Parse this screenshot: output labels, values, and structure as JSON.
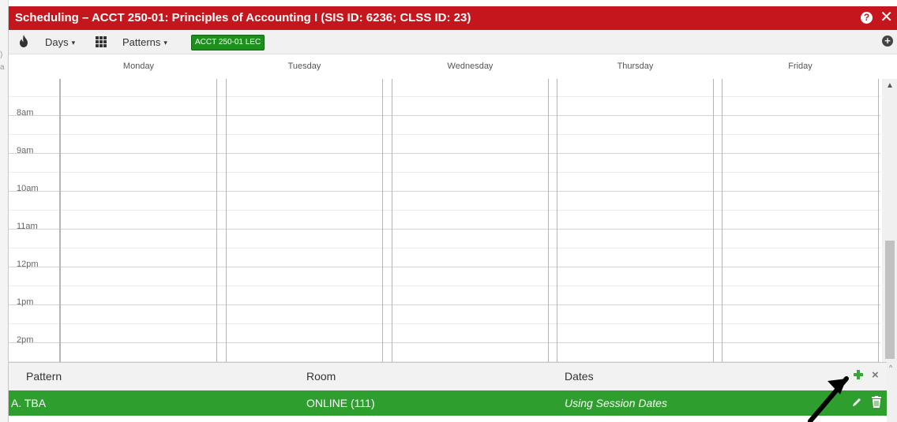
{
  "dialog": {
    "title": "Scheduling – ACCT 250-01: Principles of Accounting I (SIS ID: 6236; CLSS ID: 23)",
    "help_icon": "?",
    "close_icon": "✕"
  },
  "toolbar": {
    "days_label": "Days",
    "patterns_label": "Patterns",
    "section_badge": "ACCT 250-01 LEC",
    "add_icon": "+",
    "caret": "▾"
  },
  "calendar": {
    "days": [
      "Monday",
      "Tuesday",
      "Wednesday",
      "Thursday",
      "Friday"
    ],
    "times": [
      "8am",
      "9am",
      "10am",
      "11am",
      "12pm",
      "1pm",
      "2pm"
    ]
  },
  "patterns": {
    "headers": {
      "pattern": "Pattern",
      "room": "Room",
      "dates": "Dates"
    },
    "rows": [
      {
        "pattern": "A. TBA",
        "room": "ONLINE (111)",
        "dates": "Using Session Dates"
      }
    ]
  },
  "background": {
    "glyphs": [
      ")",
      "a"
    ]
  },
  "colors": {
    "title_bar": "#c4161c",
    "badge": "#1d8f1d",
    "selected_row": "#2e9e2e",
    "add_plus": "#3aa63a"
  },
  "icons": [
    "flame-icon",
    "grid-icon",
    "plus-circle-icon",
    "help-icon",
    "close-icon",
    "plus-icon",
    "remove-icon",
    "pencil-icon",
    "trash-icon",
    "arrow-annotation"
  ]
}
